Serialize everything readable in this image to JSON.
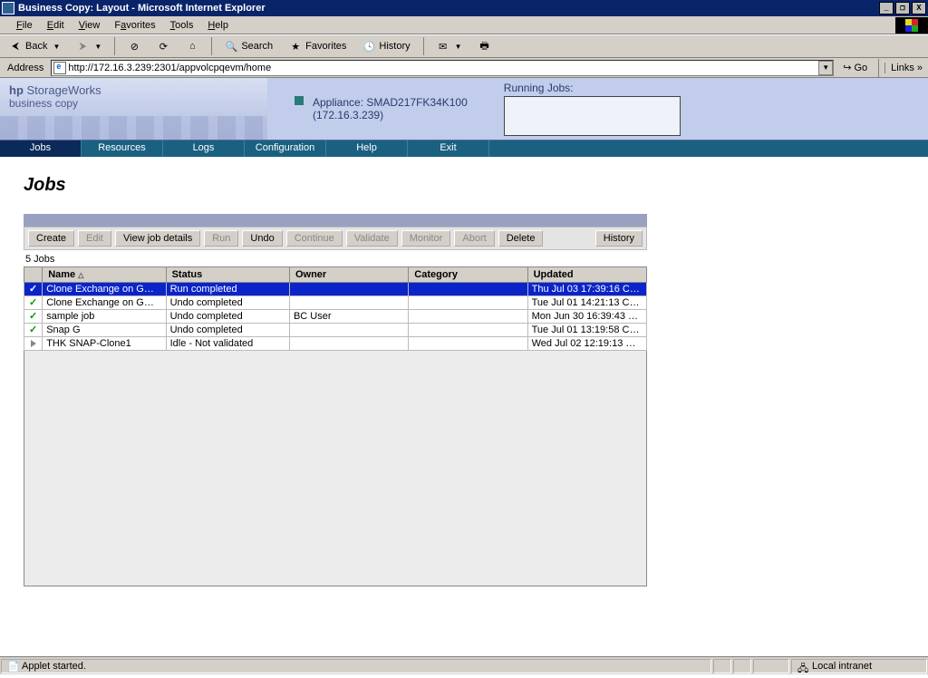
{
  "window": {
    "title": "Business Copy: Layout - Microsoft Internet Explorer"
  },
  "menu": {
    "file": "File",
    "edit": "Edit",
    "view": "View",
    "favorites": "Favorites",
    "tools": "Tools",
    "help": "Help"
  },
  "toolbar": {
    "back": "Back",
    "search": "Search",
    "favorites": "Favorites",
    "history": "History"
  },
  "address": {
    "label": "Address",
    "url": "http://172.16.3.239:2301/appvolcpqevm/home",
    "go": "Go",
    "links": "Links »"
  },
  "brand": {
    "line1a": "hp ",
    "line1b": "StorageWorks",
    "line2": "business copy"
  },
  "appliance": {
    "label": "Appliance: SMAD217FK34K100",
    "ip": "(172.16.3.239)"
  },
  "running": {
    "label": "Running Jobs:"
  },
  "nav": {
    "jobs": "Jobs",
    "resources": "Resources",
    "logs": "Logs",
    "config": "Configuration",
    "help": "Help",
    "exit": "Exit"
  },
  "page": {
    "title": "Jobs",
    "count": "5 Jobs"
  },
  "buttons": {
    "create": "Create",
    "edit": "Edit",
    "view": "View job details",
    "run": "Run",
    "undo": "Undo",
    "continue": "Continue",
    "validate": "Validate",
    "monitor": "Monitor",
    "abort": "Abort",
    "delete": "Delete",
    "history": "History"
  },
  "columns": {
    "name": "Name",
    "status": "Status",
    "owner": "Owner",
    "category": "Category",
    "updated": "Updated"
  },
  "rows": [
    {
      "icon": "check",
      "name": "Clone Exchange on G…",
      "status": "Run completed",
      "owner": "",
      "category": "",
      "updated": "Thu Jul 03 17:39:16 C…",
      "sel": true
    },
    {
      "icon": "check",
      "name": "Clone Exchange on G…",
      "status": "Undo completed",
      "owner": "",
      "category": "",
      "updated": "Tue Jul 01 14:21:13 C…",
      "sel": false
    },
    {
      "icon": "check",
      "name": "sample job",
      "status": "Undo completed",
      "owner": "BC User",
      "category": "",
      "updated": "Mon Jun 30 16:39:43 …",
      "sel": false
    },
    {
      "icon": "check",
      "name": "Snap G",
      "status": "Undo completed",
      "owner": "",
      "category": "",
      "updated": "Tue Jul 01 13:19:58 C…",
      "sel": false
    },
    {
      "icon": "tri",
      "name": "THK SNAP-Clone1",
      "status": "Idle - Not validated",
      "owner": "",
      "category": "",
      "updated": "Wed Jul 02 12:19:13 …",
      "sel": false
    }
  ],
  "status": {
    "msg": "Applet started.",
    "zone": "Local intranet"
  }
}
